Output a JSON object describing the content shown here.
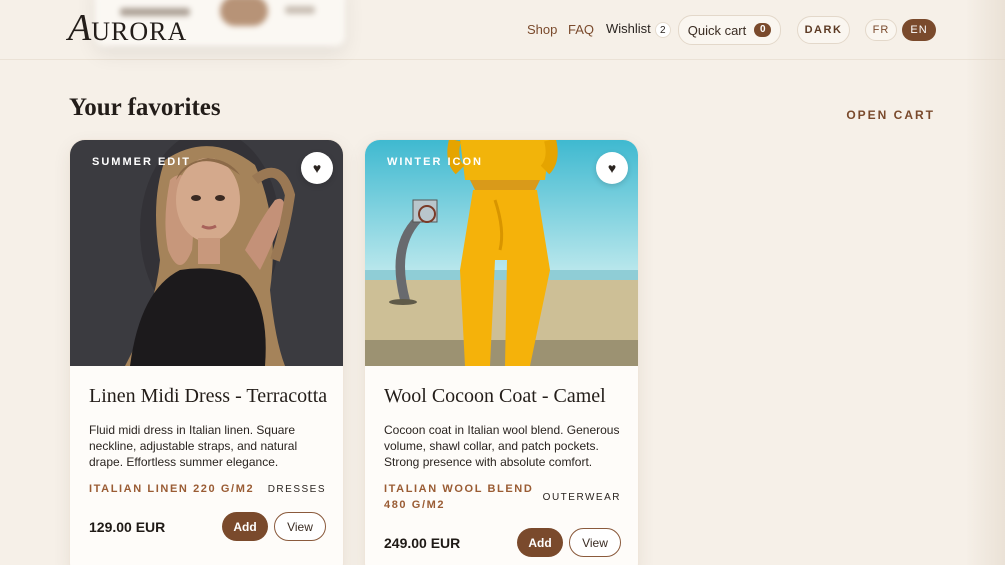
{
  "brand": {
    "initial": "A",
    "rest": "URORA"
  },
  "nav": {
    "shop": "Shop",
    "faq": "FAQ",
    "wishlist": "Wishlist",
    "wishlist_count": "2",
    "quick_cart": "Quick cart",
    "quick_cart_count": "0",
    "theme_toggle": "DARK",
    "lang_fr": "FR",
    "lang_en": "EN"
  },
  "section": {
    "title": "Your favorites",
    "open_cart": "OPEN CART"
  },
  "products": [
    {
      "tag": "SUMMER EDIT",
      "title": "Linen Midi Dress - Terracotta",
      "description": "Fluid midi dress in Italian linen. Square neckline, adjustable straps, and natural drape. Effortless summer elegance.",
      "material": "ITALIAN LINEN 220 G/M2",
      "category": "DRESSES",
      "price": "129.00 EUR",
      "add_label": "Add",
      "view_label": "View",
      "fav_icon": "♥"
    },
    {
      "tag": "WINTER ICON",
      "title": "Wool Cocoon Coat - Camel",
      "description": "Cocoon coat in Italian wool blend. Generous volume, shawl collar, and patch pockets. Strong presence with absolute comfort.",
      "material": "ITALIAN WOOL BLEND 480 G/M2",
      "category": "OUTERWEAR",
      "price": "249.00 EUR",
      "add_label": "Add",
      "view_label": "View",
      "fav_icon": "♥"
    }
  ],
  "colors": {
    "accent": "#7a4a2c",
    "background": "#f6f0e8",
    "card": "#fefcf9"
  }
}
